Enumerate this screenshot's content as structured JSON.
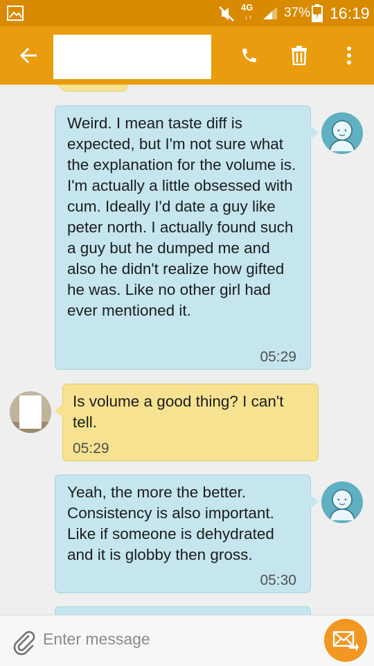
{
  "status_bar": {
    "network": "4G",
    "network_arrows": "↓↑",
    "battery": "37%",
    "time": "16:19"
  },
  "app_bar": {
    "contact_name": ""
  },
  "messages": [
    {
      "direction": "in",
      "text": "",
      "time": ""
    },
    {
      "direction": "out",
      "text": "Weird. I mean taste diff is expected, but I'm not sure what the explanation for the volume is. I'm actually a little obsessed with cum. Ideally I'd date a guy like peter north. I actually found such a guy but he dumped me and also he didn't realize how gifted he was. Like no other girl had ever mentioned it.",
      "time": "05:29"
    },
    {
      "direction": "in",
      "text": "Is volume a good thing? I can't tell.",
      "time": "05:29"
    },
    {
      "direction": "out",
      "text": "Yeah, the more the better. Consistency is also important. Like if someone is dehydrated and it is globby then gross.",
      "time": "05:30"
    },
    {
      "direction": "out",
      "text": "",
      "time": ""
    }
  ],
  "composer": {
    "placeholder": "Enter message"
  },
  "colors": {
    "status_bar": "#d88a00",
    "app_bar": "#e99c0d",
    "outgoing_bubble": "#c5e6ef",
    "incoming_bubble": "#f6e290",
    "send_button": "#f19722"
  }
}
